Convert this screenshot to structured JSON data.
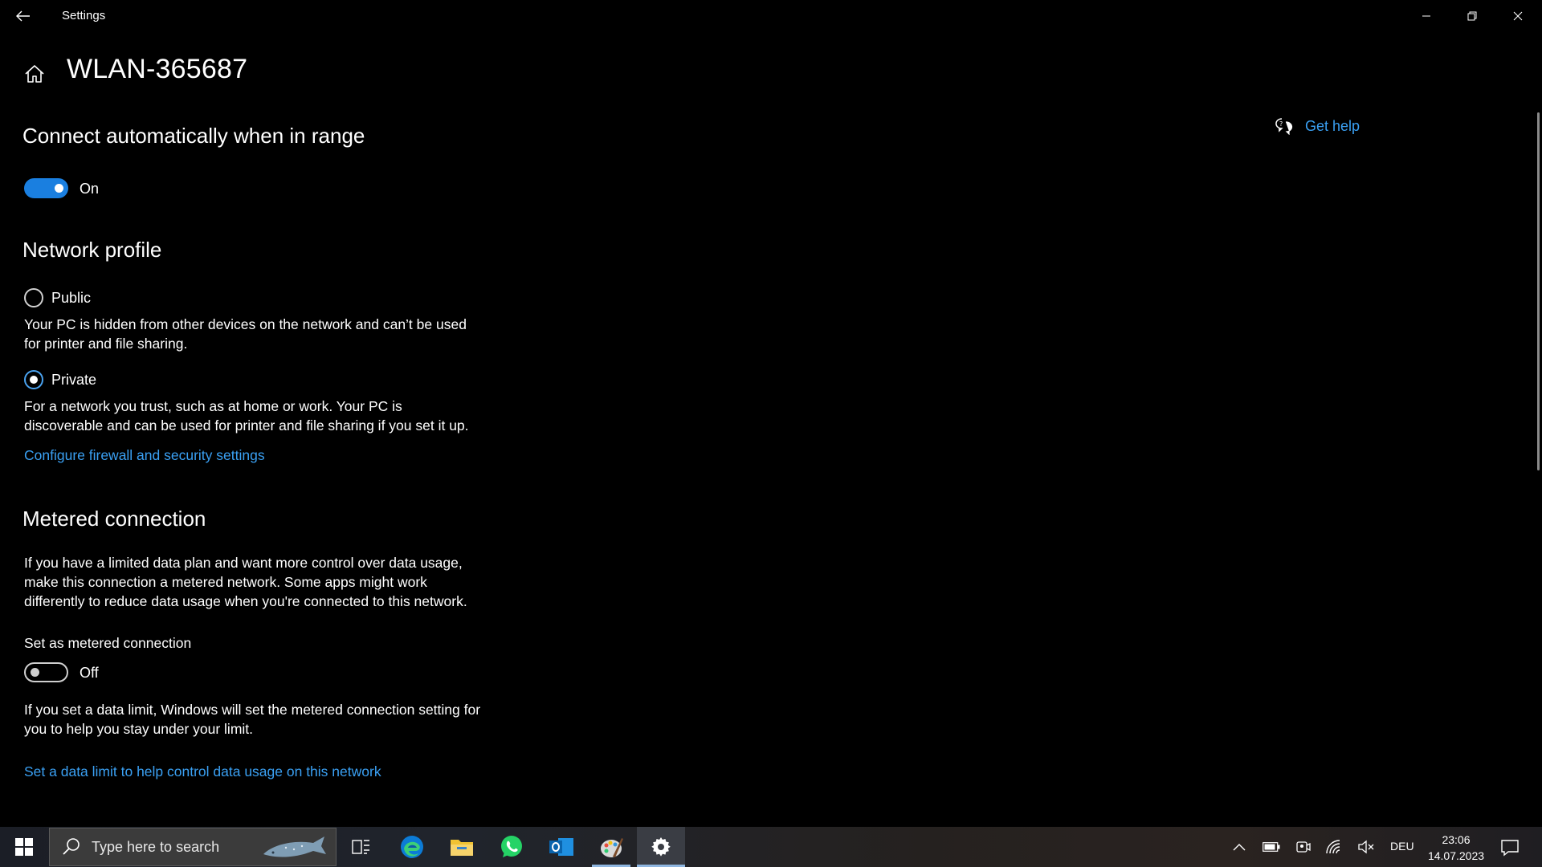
{
  "window": {
    "title": "Settings"
  },
  "page": {
    "title": "WLAN-365687",
    "get_help_label": "Get help"
  },
  "connect_auto": {
    "heading": "Connect automatically when in range",
    "toggle_state": "On",
    "toggle_on": true
  },
  "network_profile": {
    "heading": "Network profile",
    "options": [
      {
        "label": "Public",
        "description": "Your PC is hidden from other devices on the network and can’t be used for printer and file sharing.",
        "selected": false
      },
      {
        "label": "Private",
        "description": "For a network you trust, such as at home or work. Your PC is discoverable and can be used for printer and file sharing if you set it up.",
        "selected": true
      }
    ],
    "firewall_link": "Configure firewall and security settings"
  },
  "metered": {
    "heading": "Metered connection",
    "description": "If you have a limited data plan and want more control over data usage, make this connection a metered network. Some apps might work differently to reduce data usage when you're connected to this network.",
    "set_label": "Set as metered connection",
    "toggle_state": "Off",
    "toggle_on": false,
    "limit_description": "If you set a data limit, Windows will set the metered connection setting for you to help you stay under your limit.",
    "limit_link": "Set a data limit to help control data usage on this network"
  },
  "taskbar": {
    "search_placeholder": "Type here to search",
    "apps": [
      {
        "name": "task-view-icon"
      },
      {
        "name": "edge-icon"
      },
      {
        "name": "file-explorer-icon"
      },
      {
        "name": "whatsapp-icon"
      },
      {
        "name": "outlook-icon"
      },
      {
        "name": "paint-icon"
      },
      {
        "name": "settings-gear-icon"
      }
    ],
    "tray": {
      "language": "DEU",
      "time": "23:06",
      "date": "14.07.2023"
    }
  },
  "colors": {
    "accent": "#1a7fe0",
    "link": "#3aa0f3",
    "background": "#000000"
  }
}
